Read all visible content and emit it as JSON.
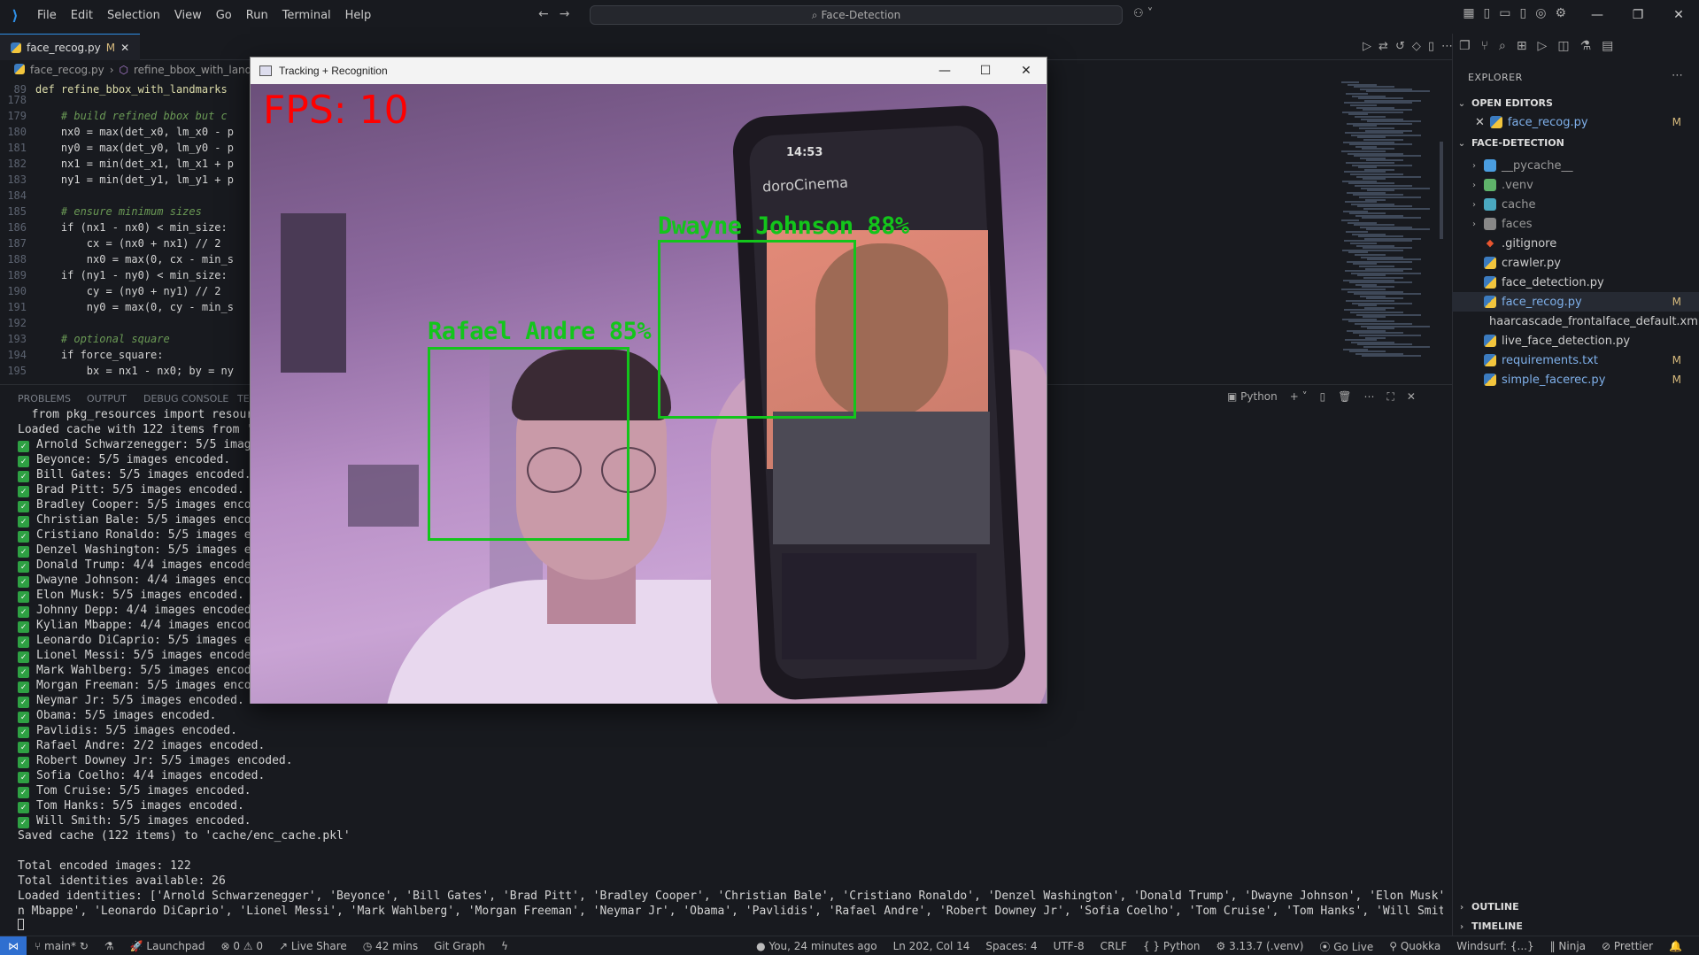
{
  "titlebar": {
    "menu": [
      "File",
      "Edit",
      "Selection",
      "View",
      "Go",
      "Run",
      "Terminal",
      "Help"
    ],
    "search": "Face-Detection"
  },
  "editor": {
    "tab": {
      "label": "face_recog.py",
      "modified": "M"
    },
    "breadcrumb": {
      "file": "face_recog.py",
      "symbol": "refine_bbox_with_landm"
    },
    "lines": [
      {
        "n": "178",
        "text": ""
      },
      {
        "n": "179",
        "text": "    # build refined bbox but c"
      },
      {
        "n": "180",
        "text": "    nx0 = max(det_x0, lm_x0 - p"
      },
      {
        "n": "181",
        "text": "    ny0 = max(det_y0, lm_y0 - p"
      },
      {
        "n": "182",
        "text": "    nx1 = min(det_x1, lm_x1 + p"
      },
      {
        "n": "183",
        "text": "    ny1 = min(det_y1, lm_y1 + p"
      },
      {
        "n": "184",
        "text": ""
      },
      {
        "n": "185",
        "text": "    # ensure minimum sizes"
      },
      {
        "n": "186",
        "text": "    if (nx1 - nx0) < min_size:"
      },
      {
        "n": "187",
        "text": "        cx = (nx0 + nx1) // 2"
      },
      {
        "n": "188",
        "text": "        nx0 = max(0, cx - min_s"
      },
      {
        "n": "189",
        "text": "    if (ny1 - ny0) < min_size:"
      },
      {
        "n": "190",
        "text": "        cy = (ny0 + ny1) // 2"
      },
      {
        "n": "191",
        "text": "        ny0 = max(0, cy - min_s"
      },
      {
        "n": "192",
        "text": ""
      },
      {
        "n": "193",
        "text": "    # optional square"
      },
      {
        "n": "194",
        "text": "    if force_square:"
      },
      {
        "n": "195",
        "text": "        bx = nx1 - nx0; by = ny"
      }
    ],
    "sticky": {
      "n": "89",
      "text": "def refine_bbox_with_landmarks"
    }
  },
  "panel": {
    "tabs": [
      "PROBLEMS",
      "OUTPUT",
      "DEBUG CONSOLE",
      "TE"
    ],
    "shell": "Python"
  },
  "terminal": {
    "head": [
      "  from pkg_resources import resource_",
      "Loaded cache with 122 items from 'cach"
    ],
    "encoded": [
      "Arnold Schwarzenegger: 5/5 images",
      "Beyonce: 5/5 images encoded.",
      "Bill Gates: 5/5 images encoded.",
      "Brad Pitt: 5/5 images encoded.",
      "Bradley Cooper: 5/5 images encoded",
      "Christian Bale: 5/5 images encoded",
      "Cristiano Ronaldo: 5/5 images enco",
      "Denzel Washington: 5/5 images enco",
      "Donald Trump: 4/4 images encoded.",
      "Dwayne Johnson: 4/4 images encoded",
      "Elon Musk: 5/5 images encoded.",
      "Johnny Depp: 4/4 images encoded.",
      "Kylian Mbappe: 4/4 images encoded.",
      "Leonardo DiCaprio: 5/5 images enco",
      "Lionel Messi: 5/5 images encoded.",
      "Mark Wahlberg: 5/5 images encoded.",
      "Morgan Freeman: 5/5 images encoded",
      "Neymar Jr: 5/5 images encoded.",
      "Obama: 5/5 images encoded.",
      "Pavlidis: 5/5 images encoded.",
      "Rafael Andre: 2/2 images encoded.",
      "Robert Downey Jr: 5/5 images encoded.",
      "Sofia Coelho: 4/4 images encoded.",
      "Tom Cruise: 5/5 images encoded.",
      "Tom Hanks: 5/5 images encoded.",
      "Will Smith: 5/5 images encoded."
    ],
    "tail": [
      "Saved cache (122 items) to 'cache/enc_cache.pkl'",
      "",
      "Total encoded images: 122",
      "Total identities available: 26",
      "Loaded identities: ['Arnold Schwarzenegger', 'Beyonce', 'Bill Gates', 'Brad Pitt', 'Bradley Cooper', 'Christian Bale', 'Cristiano Ronaldo', 'Denzel Washington', 'Donald Trump', 'Dwayne Johnson', 'Elon Musk', 'Johnny Depp', 'Kylia",
      "n Mbappe', 'Leonardo DiCaprio', 'Lionel Messi', 'Mark Wahlberg', 'Morgan Freeman', 'Neymar Jr', 'Obama', 'Pavlidis', 'Rafael Andre', 'Robert Downey Jr', 'Sofia Coelho', 'Tom Cruise', 'Tom Hanks', 'Will Smith']"
    ]
  },
  "explorer": {
    "title": "EXPLORER",
    "open_editors_label": "OPEN EDITORS",
    "open_file": "face_recog.py",
    "open_file_badge": "M",
    "project_label": "FACE-DETECTION",
    "folders": [
      "__pycache__",
      ".venv",
      "cache",
      "faces"
    ],
    "files": [
      {
        "name": ".gitignore",
        "badge": ""
      },
      {
        "name": "crawler.py",
        "badge": ""
      },
      {
        "name": "face_detection.py",
        "badge": ""
      },
      {
        "name": "face_recog.py",
        "badge": "M"
      },
      {
        "name": "haarcascade_frontalface_default.xml",
        "badge": ""
      },
      {
        "name": "live_face_detection.py",
        "badge": ""
      },
      {
        "name": "requirements.txt",
        "badge": "M"
      },
      {
        "name": "simple_facerec.py",
        "badge": "M"
      }
    ],
    "outline_label": "OUTLINE",
    "timeline_label": "TIMELINE"
  },
  "statusbar": {
    "branch": "main*",
    "launchpad": "Launchpad",
    "problems": "0 ⚠ 0",
    "live_share": "Live Share",
    "time": "42 mins",
    "git_graph": "Git Graph",
    "blame": "You, 24 minutes ago",
    "position": "Ln 202, Col 14",
    "spaces": "Spaces: 4",
    "encoding": "UTF-8",
    "eol": "CRLF",
    "language": "Python",
    "interpreter": "3.13.7 (.venv)",
    "go_live": "Go Live",
    "quokka": "Quokka",
    "windsurf": "Windsurf: {...}",
    "ninja": "Ninja",
    "prettier": "Prettier"
  },
  "cv_window": {
    "title": "Tracking + Recognition",
    "fps": "FPS: 10",
    "detections": [
      {
        "label": "Rafael Andre 85%"
      },
      {
        "label": "Dwayne Johnson 88%"
      }
    ],
    "phone_app": "doroCinema",
    "phone_time": "14:53"
  }
}
